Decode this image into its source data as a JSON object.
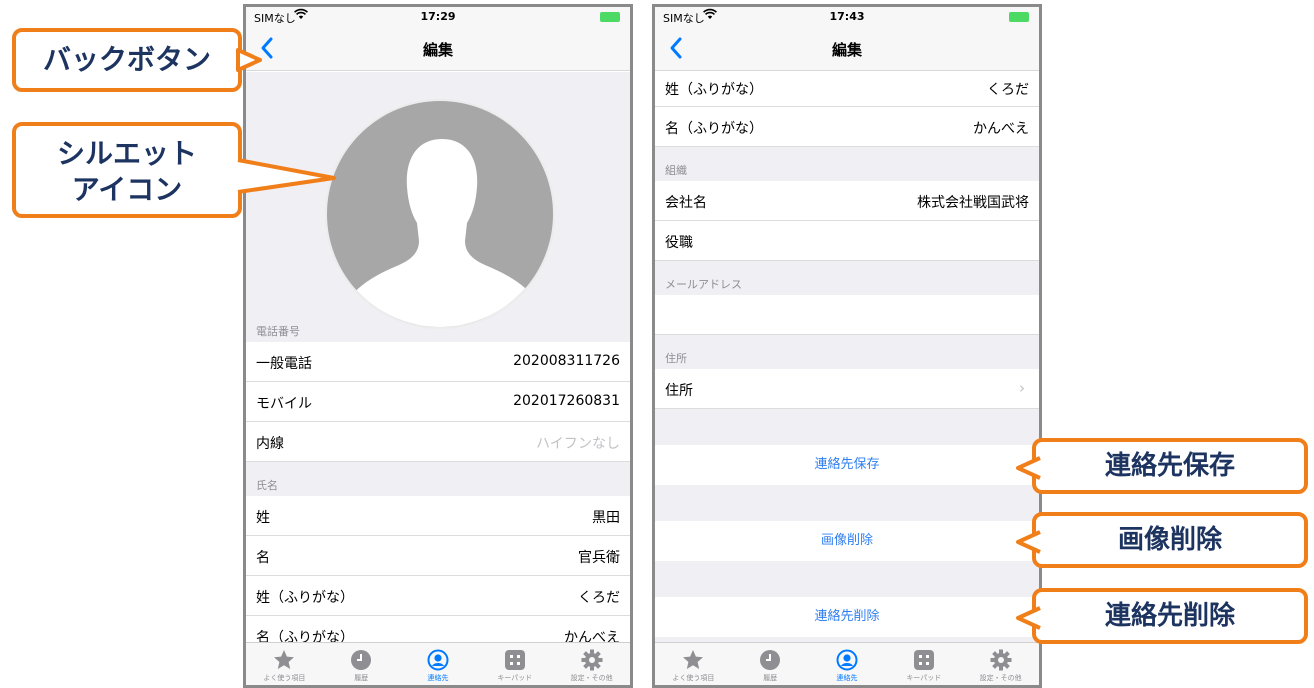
{
  "status": {
    "carrier": "SIMなし",
    "time_left": "17:29",
    "time_right": "17:43"
  },
  "nav": {
    "title": "編集"
  },
  "left_screen": {
    "phone_section": "電話番号",
    "phone_rows": [
      {
        "label": "一般電話",
        "value": "202008311726"
      },
      {
        "label": "モバイル",
        "value": "202017260831"
      },
      {
        "label": "内線",
        "placeholder": "ハイフンなし"
      }
    ],
    "name_section": "氏名",
    "name_rows": [
      {
        "label": "姓",
        "value": "黒田"
      },
      {
        "label": "名",
        "value": "官兵衛"
      },
      {
        "label": "姓（ふりがな）",
        "value": "くろだ"
      },
      {
        "label": "名（ふりがな）",
        "value": "かんべえ"
      }
    ]
  },
  "right_screen": {
    "top_rows": [
      {
        "label": "姓（ふりがな）",
        "value": "くろだ"
      },
      {
        "label": "名（ふりがな）",
        "value": "かんべえ"
      }
    ],
    "org_section": "組織",
    "org_rows": [
      {
        "label": "会社名",
        "value": "株式会社戦国武将"
      },
      {
        "label": "役職",
        "value": ""
      }
    ],
    "email_section": "メールアドレス",
    "address_section": "住所",
    "address_row": {
      "label": "住所"
    },
    "actions": {
      "save": "連絡先保存",
      "delete_image": "画像削除",
      "delete_contact": "連絡先削除"
    }
  },
  "tabs": [
    {
      "label": "よく使う項目",
      "icon": "star-icon"
    },
    {
      "label": "履歴",
      "icon": "clock-icon"
    },
    {
      "label": "連絡先",
      "icon": "person-circle-icon",
      "active": true
    },
    {
      "label": "キーパッド",
      "icon": "keypad-icon"
    },
    {
      "label": "設定・その他",
      "icon": "gear-icon"
    }
  ],
  "callouts": {
    "back": "バックボタン",
    "silhouette_line1": "シルエット",
    "silhouette_line2": "アイコン",
    "save": "連絡先保存",
    "delete_image": "画像削除",
    "delete_contact": "連絡先削除"
  },
  "colors": {
    "accent": "#007aff",
    "callout_border": "#f07f1a",
    "callout_text": "#1d3461",
    "active_battery": "#4cd964"
  }
}
